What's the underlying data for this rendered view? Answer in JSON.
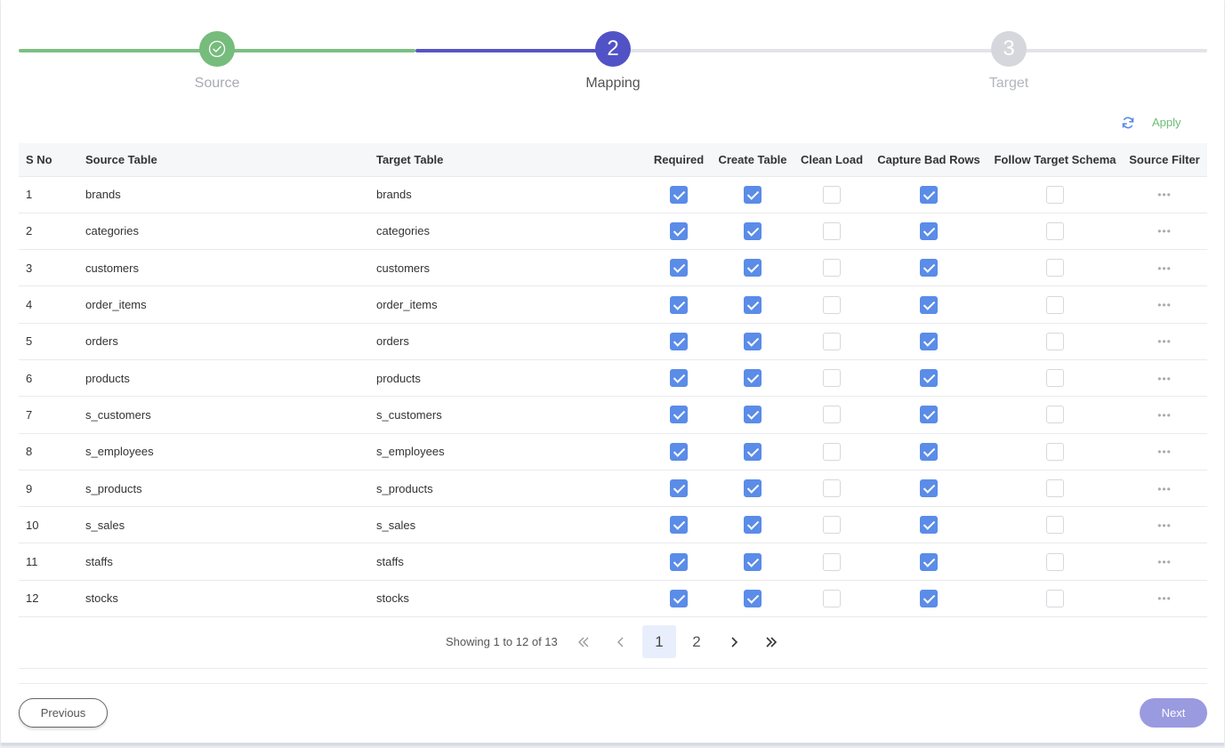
{
  "stepper": {
    "steps": [
      {
        "label": "Source",
        "status": "done",
        "badge": ""
      },
      {
        "label": "Mapping",
        "status": "active",
        "badge": "2"
      },
      {
        "label": "Target",
        "status": "pending",
        "badge": "3"
      }
    ]
  },
  "toolbar": {
    "refresh_icon": "refresh-icon",
    "apply_label": "Apply"
  },
  "table": {
    "columns": [
      "S No",
      "Source Table",
      "Target Table",
      "Required",
      "Create Table",
      "Clean Load",
      "Capture Bad Rows",
      "Follow Target Schema",
      "Source Filter"
    ],
    "rows": [
      {
        "sno": "1",
        "source": "brands",
        "target": "brands",
        "required": true,
        "create": true,
        "clean": false,
        "capture": true,
        "follow": false
      },
      {
        "sno": "2",
        "source": "categories",
        "target": "categories",
        "required": true,
        "create": true,
        "clean": false,
        "capture": true,
        "follow": false
      },
      {
        "sno": "3",
        "source": "customers",
        "target": "customers",
        "required": true,
        "create": true,
        "clean": false,
        "capture": true,
        "follow": false
      },
      {
        "sno": "4",
        "source": "order_items",
        "target": "order_items",
        "required": true,
        "create": true,
        "clean": false,
        "capture": true,
        "follow": false
      },
      {
        "sno": "5",
        "source": "orders",
        "target": "orders",
        "required": true,
        "create": true,
        "clean": false,
        "capture": true,
        "follow": false
      },
      {
        "sno": "6",
        "source": "products",
        "target": "products",
        "required": true,
        "create": true,
        "clean": false,
        "capture": true,
        "follow": false
      },
      {
        "sno": "7",
        "source": "s_customers",
        "target": "s_customers",
        "required": true,
        "create": true,
        "clean": false,
        "capture": true,
        "follow": false
      },
      {
        "sno": "8",
        "source": "s_employees",
        "target": "s_employees",
        "required": true,
        "create": true,
        "clean": false,
        "capture": true,
        "follow": false
      },
      {
        "sno": "9",
        "source": "s_products",
        "target": "s_products",
        "required": true,
        "create": true,
        "clean": false,
        "capture": true,
        "follow": false
      },
      {
        "sno": "10",
        "source": "s_sales",
        "target": "s_sales",
        "required": true,
        "create": true,
        "clean": false,
        "capture": true,
        "follow": false
      },
      {
        "sno": "11",
        "source": "staffs",
        "target": "staffs",
        "required": true,
        "create": true,
        "clean": false,
        "capture": true,
        "follow": false
      },
      {
        "sno": "12",
        "source": "stocks",
        "target": "stocks",
        "required": true,
        "create": true,
        "clean": false,
        "capture": true,
        "follow": false
      }
    ],
    "filter_glyph": "•••"
  },
  "pagination": {
    "showing": "Showing 1 to 12 of 13",
    "pages": [
      "1",
      "2"
    ],
    "current": "1"
  },
  "footer": {
    "previous_label": "Previous",
    "next_label": "Next"
  },
  "colors": {
    "accent": "#5252c7",
    "success": "#76bc7c",
    "checkbox": "#5a8ce8"
  }
}
